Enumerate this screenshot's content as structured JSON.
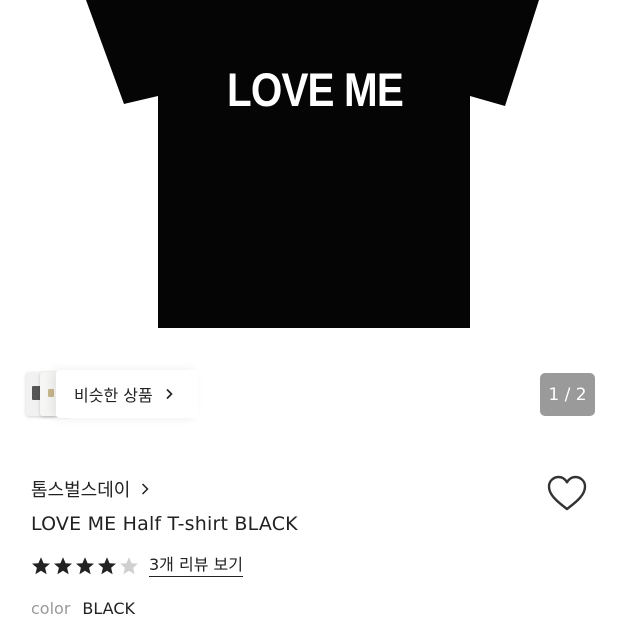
{
  "product_image": {
    "print_text": "LOVE ME",
    "shirt_color": "#050505",
    "print_color": "#ffffff"
  },
  "similar_products": {
    "label": "비슷한 상품",
    "chevron_icon": "chevron-right-icon"
  },
  "pager": {
    "text": "1 / 2",
    "current": 1,
    "total": 2
  },
  "brand": {
    "name": "톰스벌스데이",
    "chevron_icon": "chevron-right-icon"
  },
  "wishlist": {
    "icon": "heart-outline-icon"
  },
  "product": {
    "name": "LOVE ME Half T-shirt BLACK"
  },
  "rating": {
    "stars_filled": 4,
    "stars_total": 5,
    "filled_color": "#222222",
    "empty_color": "#d0d0d0",
    "review_link": "3개 리뷰 보기"
  },
  "option": {
    "label": "color",
    "value": "BLACK"
  }
}
